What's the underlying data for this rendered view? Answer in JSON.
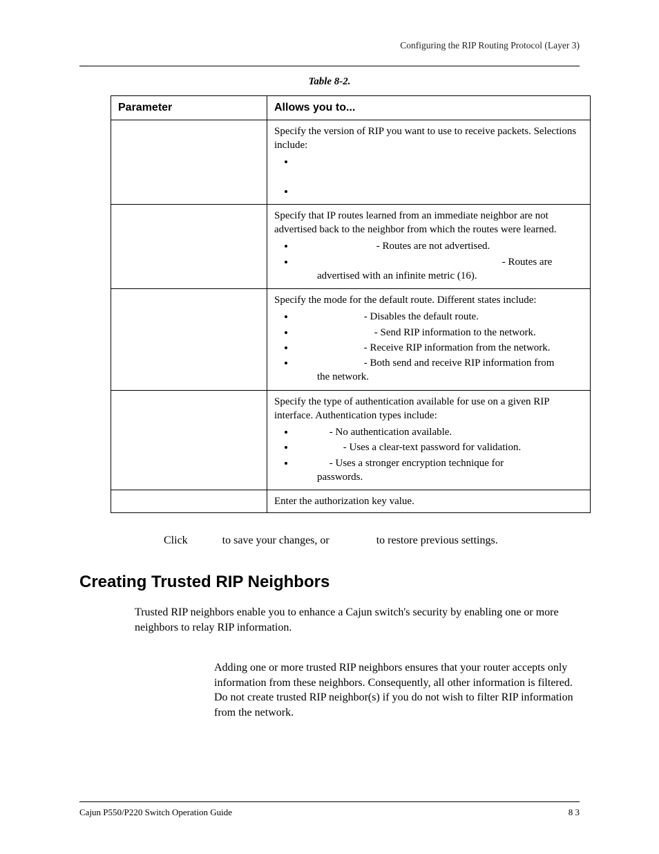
{
  "header": {
    "running": "Configuring the RIP Routing Protocol (Layer 3)"
  },
  "table": {
    "caption": "Table 8-2.",
    "head": {
      "c1": "Parameter",
      "c2": "Allows you to..."
    },
    "rows": {
      "r1": {
        "lead": "Specify the version of RIP you want to use to receive packets. Selections include:"
      },
      "r2": {
        "lead": "Specify that IP routes learned from an immediate neighbor are not advertised back to the neighbor from which the routes were learned.",
        "b1": " - Routes are not advertised.",
        "b2a": " - Routes are",
        "b2b": "advertised with an infinite metric (16)."
      },
      "r3": {
        "lead": "Specify the mode for the default route. Different states include:",
        "b1": " - Disables the default route.",
        "b2": " - Send RIP information to the network.",
        "b3": " - Receive RIP information from the network.",
        "b4a": " - Both send and receive RIP information from",
        "b4b": "the network."
      },
      "r4": {
        "lead": "Specify the type of authentication available for use on a given RIP interface. Authentication types include:",
        "b1": " - No authentication available.",
        "b2": " - Uses a clear-text password for validation.",
        "b3a": " - Uses a stronger encryption technique for",
        "b3b": "passwords."
      },
      "r5": {
        "lead": "Enter the authorization key value."
      }
    }
  },
  "step": {
    "a": "Click ",
    "b": " to save your changes, or ",
    "c": " to restore previous settings."
  },
  "section": {
    "title": "Creating Trusted RIP Neighbors",
    "intro": "Trusted RIP neighbors enable you to enhance a Cajun switch's security by enabling one or more neighbors to relay RIP information.",
    "note": "Adding one or more trusted RIP neighbors ensures that your router accepts only information from these neighbors. Consequently, all other information is filtered. Do not create trusted RIP neighbor(s) if you do not wish to filter RIP information from the network."
  },
  "footer": {
    "left": "Cajun P550/P220 Switch Operation Guide",
    "right": "8 3"
  }
}
